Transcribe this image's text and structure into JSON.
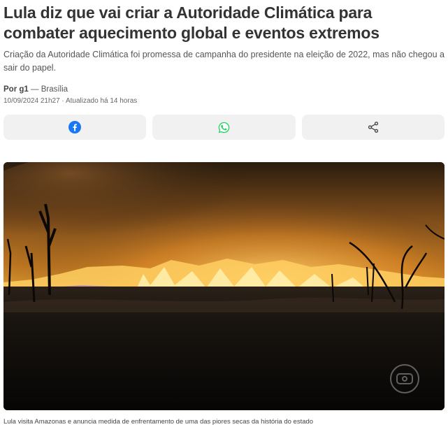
{
  "article": {
    "headline": "Lula diz que vai criar a Autoridade Climática para combater aquecimento global e eventos extremos",
    "subheadline": "Criação da Autoridade Climática foi promessa de campanha do presidente na eleição de 2022, mas não chegou a sair do papel.",
    "byline_author": "Por g1",
    "byline_separator": " — ",
    "byline_location": "Brasília",
    "dateline": "10/09/2024 21h27 · Atualizado há 14 horas"
  },
  "share": {
    "buttons": [
      {
        "icon": "facebook-icon",
        "color": "#1877f2"
      },
      {
        "icon": "whatsapp-icon",
        "color": "#25d366"
      },
      {
        "icon": "share-icon",
        "color": "#444444"
      }
    ]
  },
  "media": {
    "image_description_icon": "globo-watermark-icon",
    "caption": "Lula visita Amazonas e anuncia medida de enfrentamento de uma das piores secas da história do estado"
  }
}
